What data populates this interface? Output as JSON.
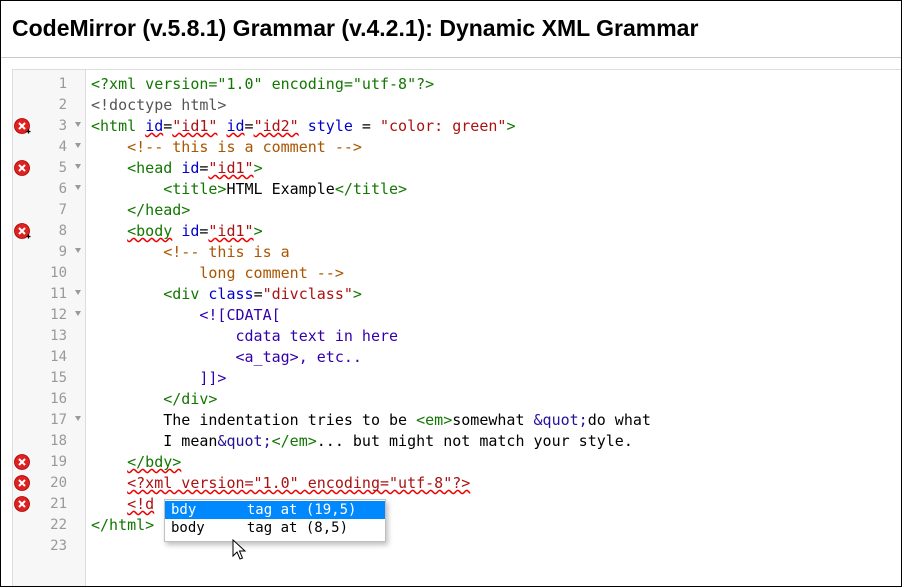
{
  "page": {
    "title": "CodeMirror (v.5.8.1) Grammar (v.4.2.1): Dynamic XML Grammar"
  },
  "editor": {
    "lines": [
      {
        "num": "1",
        "fold": false,
        "marker": "",
        "segments": [
          {
            "c": "t",
            "text": "<?xml version=\"1.0\" encoding=\"utf-8\"?>"
          }
        ]
      },
      {
        "num": "2",
        "fold": false,
        "marker": "",
        "segments": [
          {
            "c": "x",
            "text": "<!doctype html>"
          }
        ]
      },
      {
        "num": "3",
        "fold": true,
        "marker": "error-plus",
        "segments": [
          {
            "c": "t",
            "text": "<html "
          },
          {
            "c": "a err",
            "text": "id"
          },
          {
            "c": "p",
            "text": "="
          },
          {
            "c": "s err",
            "text": "\"id1\""
          },
          {
            "c": "p",
            "text": " "
          },
          {
            "c": "a err",
            "text": "id"
          },
          {
            "c": "p",
            "text": "="
          },
          {
            "c": "s err",
            "text": "\"id2\""
          },
          {
            "c": "p",
            "text": " "
          },
          {
            "c": "a",
            "text": "style"
          },
          {
            "c": "p",
            "text": " = "
          },
          {
            "c": "s",
            "text": "\"color: green\""
          },
          {
            "c": "t",
            "text": ">"
          }
        ]
      },
      {
        "num": "4",
        "fold": true,
        "marker": "",
        "segments": [
          {
            "c": "p",
            "text": "    "
          },
          {
            "c": "c",
            "text": "<!-- this is a comment -->"
          }
        ]
      },
      {
        "num": "5",
        "fold": true,
        "marker": "error",
        "segments": [
          {
            "c": "p",
            "text": "    "
          },
          {
            "c": "t",
            "text": "<head "
          },
          {
            "c": "a",
            "text": "id"
          },
          {
            "c": "p",
            "text": "="
          },
          {
            "c": "s err",
            "text": "\"id1\""
          },
          {
            "c": "t",
            "text": ">"
          }
        ]
      },
      {
        "num": "6",
        "fold": true,
        "marker": "",
        "segments": [
          {
            "c": "p",
            "text": "        "
          },
          {
            "c": "t",
            "text": "<title>"
          },
          {
            "c": "p",
            "text": "HTML Example"
          },
          {
            "c": "t",
            "text": "</title>"
          }
        ]
      },
      {
        "num": "7",
        "fold": false,
        "marker": "",
        "segments": [
          {
            "c": "p",
            "text": "    "
          },
          {
            "c": "t",
            "text": "</head>"
          }
        ]
      },
      {
        "num": "8",
        "fold": false,
        "marker": "error-plus",
        "segments": [
          {
            "c": "p",
            "text": "    "
          },
          {
            "c": "t err",
            "text": "<body"
          },
          {
            "c": "t",
            "text": " "
          },
          {
            "c": "a",
            "text": "id"
          },
          {
            "c": "p",
            "text": "="
          },
          {
            "c": "s err",
            "text": "\"id1\""
          },
          {
            "c": "t",
            "text": ">"
          }
        ]
      },
      {
        "num": "9",
        "fold": true,
        "marker": "",
        "segments": [
          {
            "c": "p",
            "text": "        "
          },
          {
            "c": "c",
            "text": "<!-- this is a"
          }
        ]
      },
      {
        "num": "10",
        "fold": false,
        "marker": "",
        "segments": [
          {
            "c": "p",
            "text": "            "
          },
          {
            "c": "c",
            "text": "long comment -->"
          }
        ]
      },
      {
        "num": "11",
        "fold": true,
        "marker": "",
        "segments": [
          {
            "c": "p",
            "text": "        "
          },
          {
            "c": "t",
            "text": "<div "
          },
          {
            "c": "a",
            "text": "class"
          },
          {
            "c": "p",
            "text": "="
          },
          {
            "c": "s",
            "text": "\"divclass\""
          },
          {
            "c": "t",
            "text": ">"
          }
        ]
      },
      {
        "num": "12",
        "fold": true,
        "marker": "",
        "segments": [
          {
            "c": "p",
            "text": "            "
          },
          {
            "c": "k",
            "text": "<![CDATA["
          }
        ]
      },
      {
        "num": "13",
        "fold": false,
        "marker": "",
        "segments": [
          {
            "c": "p",
            "text": "                "
          },
          {
            "c": "k",
            "text": "cdata text in here"
          }
        ]
      },
      {
        "num": "14",
        "fold": false,
        "marker": "",
        "segments": [
          {
            "c": "p",
            "text": "                "
          },
          {
            "c": "k",
            "text": "<a_tag>, etc.."
          }
        ]
      },
      {
        "num": "15",
        "fold": false,
        "marker": "",
        "segments": [
          {
            "c": "p",
            "text": "            "
          },
          {
            "c": "k",
            "text": "]]>"
          }
        ]
      },
      {
        "num": "16",
        "fold": false,
        "marker": "",
        "segments": [
          {
            "c": "p",
            "text": "        "
          },
          {
            "c": "t",
            "text": "</div>"
          }
        ]
      },
      {
        "num": "17",
        "fold": true,
        "marker": "",
        "segments": [
          {
            "c": "p",
            "text": "        The indentation tries to be "
          },
          {
            "c": "t",
            "text": "<em>"
          },
          {
            "c": "p",
            "text": "somewhat "
          },
          {
            "c": "e",
            "text": "&quot;"
          },
          {
            "c": "p",
            "text": "do what"
          }
        ]
      },
      {
        "num": "18",
        "fold": false,
        "marker": "",
        "segments": [
          {
            "c": "p",
            "text": "        I mean"
          },
          {
            "c": "e",
            "text": "&quot;"
          },
          {
            "c": "t",
            "text": "</em>"
          },
          {
            "c": "p",
            "text": "... but might not match your style."
          }
        ]
      },
      {
        "num": "19",
        "fold": false,
        "marker": "error",
        "segments": [
          {
            "c": "p",
            "text": "    "
          },
          {
            "c": "t err",
            "text": "</bdy>"
          }
        ]
      },
      {
        "num": "20",
        "fold": false,
        "marker": "error",
        "segments": [
          {
            "c": "p",
            "text": "    "
          },
          {
            "c": "s err",
            "text": "<?xml version=\"1.0\" encoding=\"utf-8\"?>"
          }
        ]
      },
      {
        "num": "21",
        "fold": false,
        "marker": "error",
        "segments": [
          {
            "c": "p",
            "text": "    "
          },
          {
            "c": "s err",
            "text": "<!d"
          }
        ]
      },
      {
        "num": "22",
        "fold": false,
        "marker": "",
        "segments": [
          {
            "c": "t",
            "text": "</html>"
          }
        ]
      },
      {
        "num": "23",
        "fold": false,
        "marker": "",
        "segments": []
      }
    ]
  },
  "hint_popup": {
    "items": [
      {
        "text": "bdy      tag at (19,5)",
        "active": true
      },
      {
        "text": "body     tag at (8,5)",
        "active": false
      }
    ]
  },
  "icons": {
    "error_marker": "error-circle-icon",
    "error_plus_marker": "error-circle-plus-icon",
    "fold": "fold-arrow-icon",
    "cursor": "mouse-pointer-icon"
  },
  "colors": {
    "tag": "#117700",
    "attribute": "#0000cc",
    "string": "#aa1111",
    "comment": "#aa5500",
    "cdata": "#3300aa",
    "error": "#dd2222",
    "hint_active": "#0088ff"
  }
}
